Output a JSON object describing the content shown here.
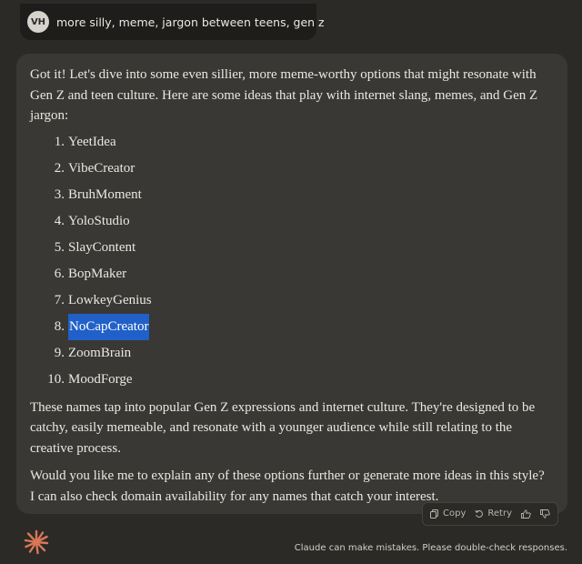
{
  "user_message": {
    "avatar_initials": "VH",
    "text": "more silly, meme, jargon between teens, gen z"
  },
  "assistant_message": {
    "intro": "Got it! Let's dive into some even sillier, more meme-worthy options that might resonate with Gen Z and teen culture. Here are some ideas that play with internet slang, memes, and Gen Z jargon:",
    "items": [
      {
        "num": "1.",
        "label": "YeetIdea"
      },
      {
        "num": "2.",
        "label": "VibeCreator"
      },
      {
        "num": "3.",
        "label": "BruhMoment"
      },
      {
        "num": "4.",
        "label": "YoloStudio"
      },
      {
        "num": "5.",
        "label": "SlayContent"
      },
      {
        "num": "6.",
        "label": "BopMaker"
      },
      {
        "num": "7.",
        "label": "LowkeyGenius"
      },
      {
        "num": "8.",
        "label": "NoCapCreator"
      },
      {
        "num": "9.",
        "label": "ZoomBrain"
      },
      {
        "num": "10.",
        "label": "MoodForge"
      }
    ],
    "highlighted_item_index": 7,
    "after_list": "These names tap into popular Gen Z expressions and internet culture. They're designed to be catchy, easily memeable, and resonate with a younger audience while still relating to the creative process.",
    "closing": "Would you like me to explain any of these options further or generate more ideas in this style? I can also check domain availability for any names that catch your interest."
  },
  "actions": {
    "copy_label": "Copy",
    "retry_label": "Retry",
    "copy_icon": "copy-icon",
    "retry_icon": "retry-icon",
    "thumbs_up_icon": "thumbs-up-icon",
    "thumbs_down_icon": "thumbs-down-icon"
  },
  "footer": {
    "disclaimer": "Claude can make mistakes. Please double-check responses."
  },
  "colors": {
    "background": "#2b2a27",
    "card": "#393835",
    "user_bubble": "#1e1d1b",
    "selection": "#2060c8",
    "logo": "#d97757"
  }
}
